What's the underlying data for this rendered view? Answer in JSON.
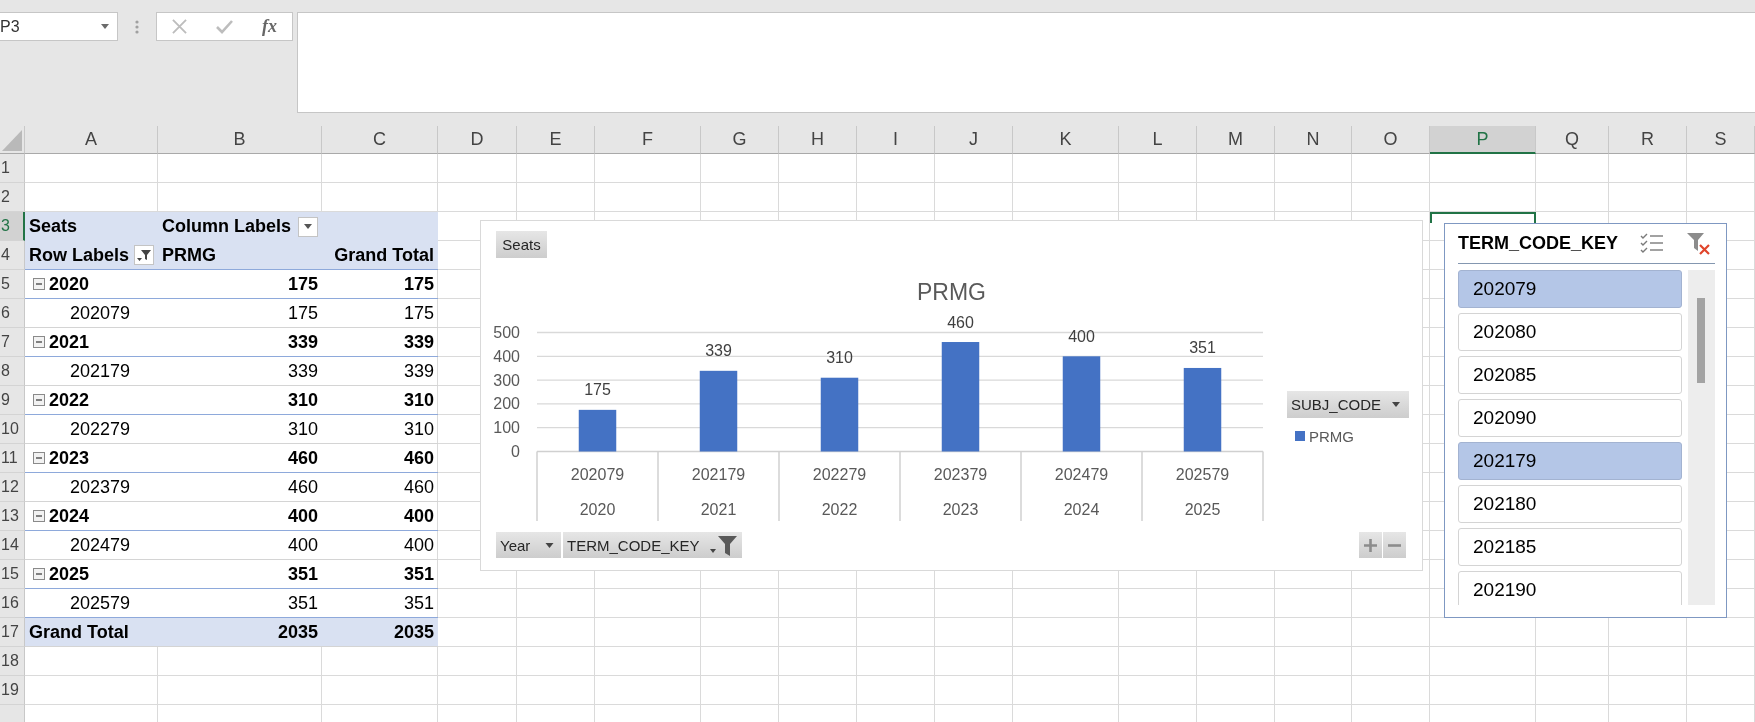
{
  "formula_bar": {
    "name_box": "P3",
    "buttons": [
      {
        "kind": "cancel",
        "disabled": true
      },
      {
        "kind": "enter",
        "disabled": true
      },
      {
        "kind": "function",
        "label": "fx",
        "disabled": false
      }
    ]
  },
  "sheet": {
    "columns": [
      {
        "label": "A",
        "selected": false
      },
      {
        "label": "B",
        "selected": false
      },
      {
        "label": "C",
        "selected": false
      },
      {
        "label": "D",
        "selected": false
      },
      {
        "label": "E",
        "selected": false
      },
      {
        "label": "F",
        "selected": false
      },
      {
        "label": "G",
        "selected": false
      },
      {
        "label": "H",
        "selected": false
      },
      {
        "label": "I",
        "selected": false
      },
      {
        "label": "J",
        "selected": false
      },
      {
        "label": "K",
        "selected": false
      },
      {
        "label": "L",
        "selected": false
      },
      {
        "label": "M",
        "selected": false
      },
      {
        "label": "N",
        "selected": false
      },
      {
        "label": "O",
        "selected": false
      },
      {
        "label": "P",
        "selected": true
      },
      {
        "label": "Q",
        "selected": false
      },
      {
        "label": "R",
        "selected": false
      },
      {
        "label": "S",
        "selected": false
      }
    ],
    "rows": [
      {
        "label": "1",
        "selected": false
      },
      {
        "label": "2",
        "selected": false
      },
      {
        "label": "3",
        "selected": true
      },
      {
        "label": "4",
        "selected": false
      },
      {
        "label": "5",
        "selected": false
      },
      {
        "label": "6",
        "selected": false
      },
      {
        "label": "7",
        "selected": false
      },
      {
        "label": "8",
        "selected": false
      },
      {
        "label": "9",
        "selected": false
      },
      {
        "label": "10",
        "selected": false
      },
      {
        "label": "11",
        "selected": false
      },
      {
        "label": "12",
        "selected": false
      },
      {
        "label": "13",
        "selected": false
      },
      {
        "label": "14",
        "selected": false
      },
      {
        "label": "15",
        "selected": false
      },
      {
        "label": "16",
        "selected": false
      },
      {
        "label": "17",
        "selected": false
      },
      {
        "label": "18",
        "selected": false
      },
      {
        "label": "19",
        "selected": false
      }
    ]
  },
  "pivot_table": {
    "value_field": "Seats",
    "column_labels": {
      "label": "Column Labels",
      "filtered": false
    },
    "row_labels": {
      "label": "Row Labels",
      "filtered": true
    },
    "column_header": "PRMG",
    "total_header": "Grand Total",
    "rows": [
      {
        "label": "2020",
        "expanded": true,
        "value": "175",
        "total": "175",
        "children": [
          {
            "label": "202079",
            "value": "175",
            "total": "175"
          }
        ]
      },
      {
        "label": "2021",
        "expanded": true,
        "value": "339",
        "total": "339",
        "children": [
          {
            "label": "202179",
            "value": "339",
            "total": "339"
          }
        ]
      },
      {
        "label": "2022",
        "expanded": true,
        "value": "310",
        "total": "310",
        "children": [
          {
            "label": "202279",
            "value": "310",
            "total": "310"
          }
        ]
      },
      {
        "label": "2023",
        "expanded": true,
        "value": "460",
        "total": "460",
        "children": [
          {
            "label": "202379",
            "value": "460",
            "total": "460"
          }
        ]
      },
      {
        "label": "2024",
        "expanded": true,
        "value": "400",
        "total": "400",
        "children": [
          {
            "label": "202479",
            "value": "400",
            "total": "400"
          }
        ]
      },
      {
        "label": "2025",
        "expanded": true,
        "value": "351",
        "total": "351",
        "children": [
          {
            "label": "202579",
            "value": "351",
            "total": "351"
          }
        ]
      }
    ],
    "grand_total": {
      "label": "Grand Total",
      "value": "2035",
      "total": "2035"
    }
  },
  "chart": {
    "value_button": "Seats",
    "chart_data": {
      "type": "bar",
      "title": "PRMG",
      "categories": [
        "202079",
        "202179",
        "202279",
        "202379",
        "202479",
        "202579"
      ],
      "series": [
        {
          "name": "PRMG",
          "color": "#4472c4",
          "values": [
            175,
            339,
            310,
            460,
            400,
            351
          ]
        }
      ],
      "ylim": [
        0,
        500
      ],
      "yticks": [
        0,
        100,
        200,
        300,
        400,
        500
      ],
      "grid": true,
      "data_labels": true
    },
    "category_groups": [
      "2020",
      "2021",
      "2022",
      "2023",
      "2024",
      "2025"
    ],
    "field_buttons": [
      {
        "label": "Year",
        "filtered": false
      },
      {
        "label": "TERM_CODE_KEY",
        "filtered": true
      }
    ],
    "legend_button": {
      "label": "SUBJ_CODE",
      "filtered": false
    },
    "zoom_buttons": [
      {
        "kind": "expand"
      },
      {
        "kind": "collapse"
      }
    ]
  },
  "slicer": {
    "title": "TERM_CODE_KEY",
    "items": [
      {
        "label": "202079",
        "selected": true
      },
      {
        "label": "202080",
        "selected": false
      },
      {
        "label": "202085",
        "selected": false
      },
      {
        "label": "202090",
        "selected": false
      },
      {
        "label": "202179",
        "selected": true
      },
      {
        "label": "202180",
        "selected": false
      },
      {
        "label": "202185",
        "selected": false
      },
      {
        "label": "202190",
        "selected": false
      }
    ]
  }
}
